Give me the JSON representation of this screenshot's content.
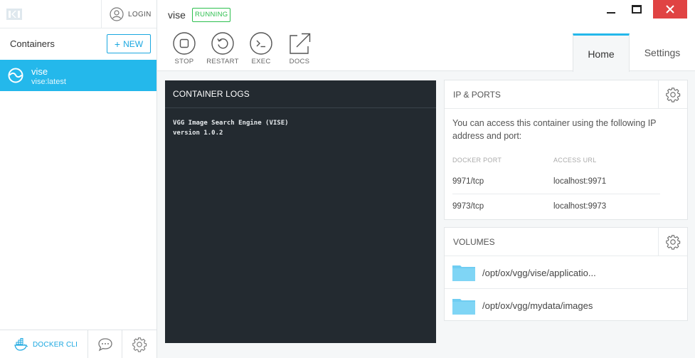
{
  "sidebar": {
    "login_label": "LOGIN",
    "containers_title": "Containers",
    "new_label": "NEW",
    "container": {
      "name": "vise",
      "image": "vise:latest"
    },
    "docker_cli_label": "DOCKER CLI"
  },
  "header": {
    "container_name": "vise",
    "status": "RUNNING",
    "actions": [
      {
        "label": "STOP",
        "icon": "stop-icon"
      },
      {
        "label": "RESTART",
        "icon": "restart-icon"
      },
      {
        "label": "EXEC",
        "icon": "terminal-icon"
      },
      {
        "label": "DOCS",
        "icon": "external-link-icon"
      }
    ],
    "tabs": [
      {
        "label": "Home",
        "active": true
      },
      {
        "label": "Settings",
        "active": false
      }
    ]
  },
  "logs": {
    "title": "CONTAINER LOGS",
    "lines": [
      "VGG Image Search Engine (VISE)",
      "version 1.0.2"
    ]
  },
  "ip_ports": {
    "title": "IP & PORTS",
    "description": "You can access this container using the following IP address and port:",
    "col_docker_port": "DOCKER PORT",
    "col_access_url": "ACCESS URL",
    "rows": [
      {
        "port": "9971/tcp",
        "url": "localhost:9971"
      },
      {
        "port": "9973/tcp",
        "url": "localhost:9973"
      }
    ]
  },
  "volumes": {
    "title": "VOLUMES",
    "items": [
      "/opt/ox/vgg/vise/applicatio...",
      "/opt/ox/vgg/mydata/images"
    ]
  },
  "colors": {
    "accent": "#24b8eb",
    "running": "#2cbf4e",
    "logs_bg": "#232a30",
    "close": "#e04343"
  }
}
